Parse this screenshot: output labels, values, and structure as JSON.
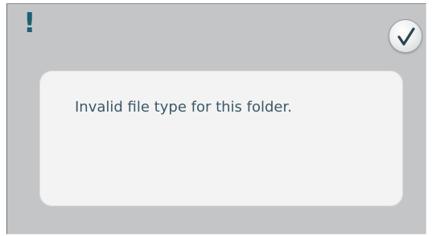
{
  "dialog": {
    "alert_symbol": "!",
    "message": "Invalid file type for this folder.",
    "confirm_icon": "checkmark-icon"
  },
  "colors": {
    "background": "#c3c5c7",
    "panel": "#f3f3f3",
    "accent": "#1f5f75",
    "text": "#3b5968"
  }
}
